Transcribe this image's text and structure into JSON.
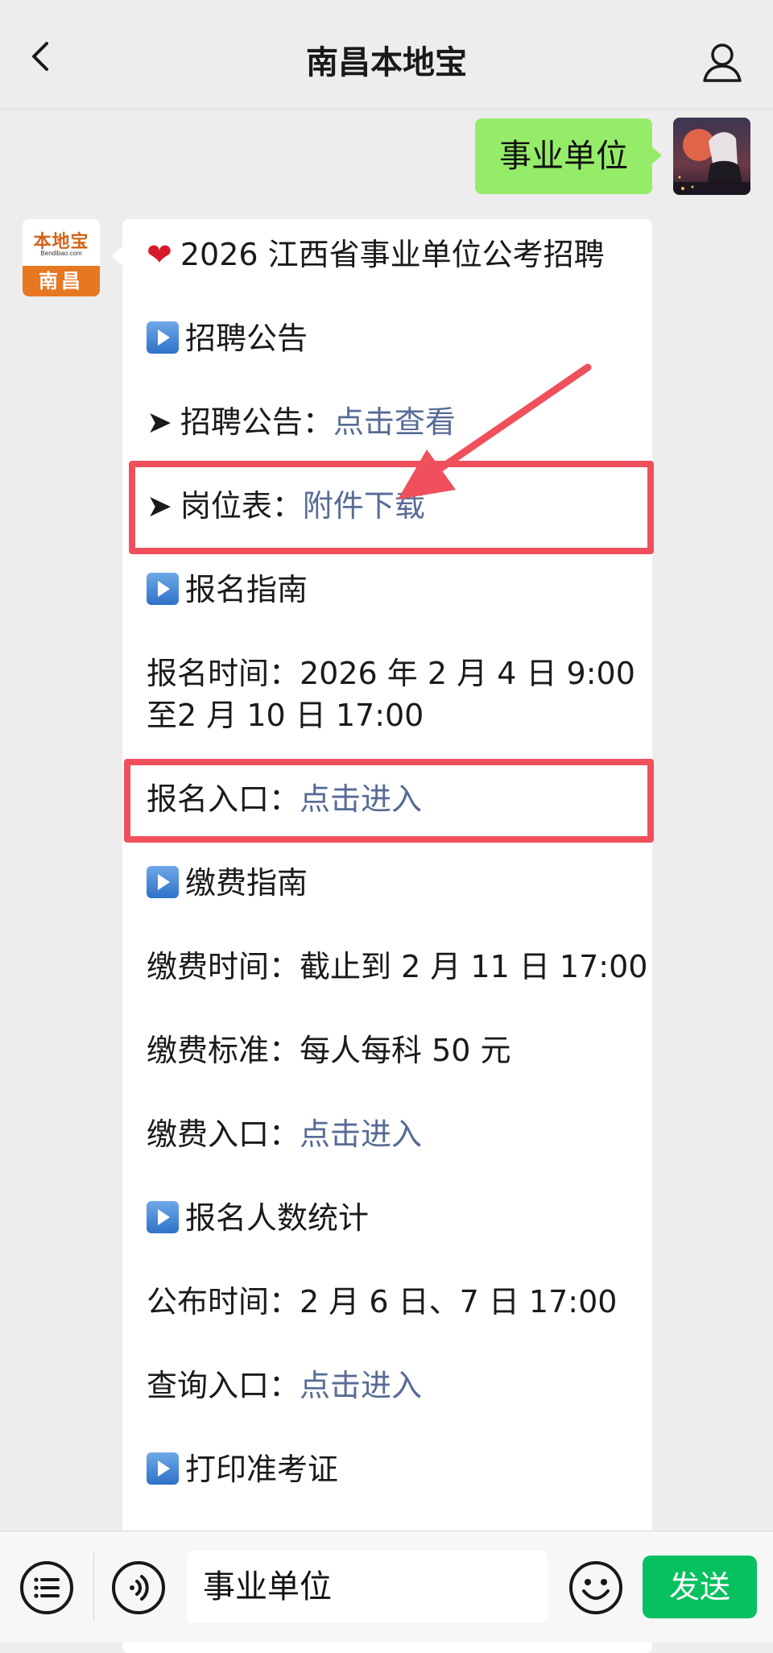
{
  "header": {
    "title": "南昌本地宝"
  },
  "outgoing": {
    "text": "事业单位"
  },
  "sender": {
    "logo_text": "本地宝",
    "logo_sub": "Bendibao.com",
    "city": "南昌"
  },
  "message": {
    "heading": "2026 江西省事业单位公考招聘",
    "sec_recruit": "招聘公告",
    "recruit_notice_label": "招聘公告：",
    "recruit_notice_link": "点击查看",
    "post_table_label": "岗位表：",
    "post_table_link": "附件下载",
    "sec_register": "报名指南",
    "register_time_line1": "报名时间：2026 年 2 月 4 日 9:00",
    "register_time_line2": "至2 月 10 日 17:00",
    "register_entry_label": "报名入口：",
    "register_entry_link": "点击进入",
    "sec_fee": "缴费指南",
    "fee_time": "缴费时间：截止到 2 月 11 日 17:00",
    "fee_standard": "缴费标准：每人每科 50 元",
    "fee_entry_label": "缴费入口：",
    "fee_entry_link": "点击进入",
    "sec_stats": "报名人数统计",
    "publish_time": "公布时间：2 月 6 日、7 日 17:00",
    "query_entry_label": "查询入口：",
    "query_entry_link": "点击进入",
    "sec_print": "打印准考证"
  },
  "bottom": {
    "input_value": "事业单位",
    "send_label": "发送"
  },
  "colors": {
    "bubble_out": "#95ec69",
    "link": "#576b95",
    "highlight": "#f0505b",
    "send": "#07c160"
  }
}
